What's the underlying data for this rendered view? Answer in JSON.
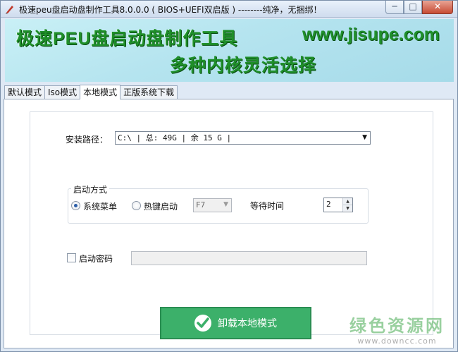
{
  "window": {
    "title": "极速peu盘启动盘制作工具8.0.0.0 ( BIOS+UEFI双启版 ) --------纯净，无捆绑！",
    "controls": {
      "minimize": "─",
      "maximize": "□",
      "close": "✕"
    }
  },
  "banner": {
    "title": "极速PEU盘启动盘制作工具",
    "url": "www.jisupe.com",
    "subtitle": "多种内核灵活选择"
  },
  "tabs": [
    {
      "label": "默认模式",
      "active": false
    },
    {
      "label": "Iso模式",
      "active": false
    },
    {
      "label": "本地模式",
      "active": true
    },
    {
      "label": "正版系统下载",
      "active": false
    }
  ],
  "install_path": {
    "label": "安装路径：",
    "value": "C:\\ | 总: 49G | 余 15 G |"
  },
  "boot_mode": {
    "title": "启动方式",
    "options": [
      {
        "label": "系统菜单",
        "checked": true
      },
      {
        "label": "热键启动",
        "checked": false
      }
    ],
    "hotkey_value": "F7",
    "wait_label": "等待时间",
    "wait_value": "2"
  },
  "boot_password": {
    "label": "启动密码",
    "checked": false,
    "value": ""
  },
  "action_button": {
    "label": "卸载本地模式",
    "icon": "check-circle-icon",
    "color": "#3cb06a"
  },
  "watermark": {
    "main": "绿色资源网",
    "sub": "www.downcc.com"
  }
}
